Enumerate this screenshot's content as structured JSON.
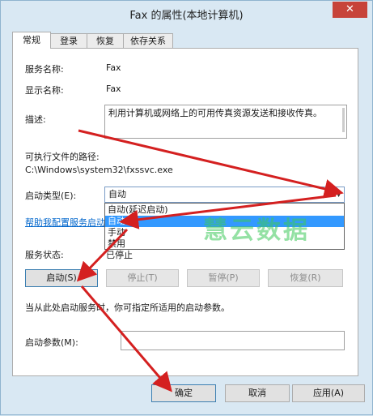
{
  "window": {
    "title": "Fax 的属性(本地计算机)",
    "close_glyph": "✕"
  },
  "tabs": [
    {
      "label": "常规",
      "active": true
    },
    {
      "label": "登录"
    },
    {
      "label": "恢复"
    },
    {
      "label": "依存关系"
    }
  ],
  "general": {
    "service_name_label": "服务名称:",
    "service_name_value": "Fax",
    "display_name_label": "显示名称:",
    "display_name_value": "Fax",
    "description_label": "描述:",
    "description_value": "利用计算机或网络上的可用传真资源发送和接收传真。",
    "exe_path_label": "可执行文件的路径:",
    "exe_path_value": "C:\\Windows\\system32\\fxssvc.exe",
    "startup_type_label": "启动类型(E):",
    "startup_type_value": "自动",
    "startup_options": [
      "自动(延迟启动)",
      "自动",
      "手动",
      "禁用"
    ],
    "startup_selected_index": 1,
    "help_link": "帮助我配置服务启动",
    "status_label": "服务状态:",
    "status_value": "已停止",
    "start_hint": "当从此处启动服务时，你可指定所适用的启动参数。",
    "start_params_label": "启动参数(M):",
    "start_params_value": ""
  },
  "service_buttons": {
    "start": "启动(S)",
    "stop": "停止(T)",
    "pause": "暂停(P)",
    "resume": "恢复(R)"
  },
  "footer_buttons": {
    "ok": "确定",
    "cancel": "取消",
    "apply": "应用(A)"
  },
  "watermark": "慧云数据",
  "colors": {
    "selection": "#3399ff",
    "link": "#0066cc",
    "arrow": "#d42020",
    "close": "#c7433a"
  }
}
